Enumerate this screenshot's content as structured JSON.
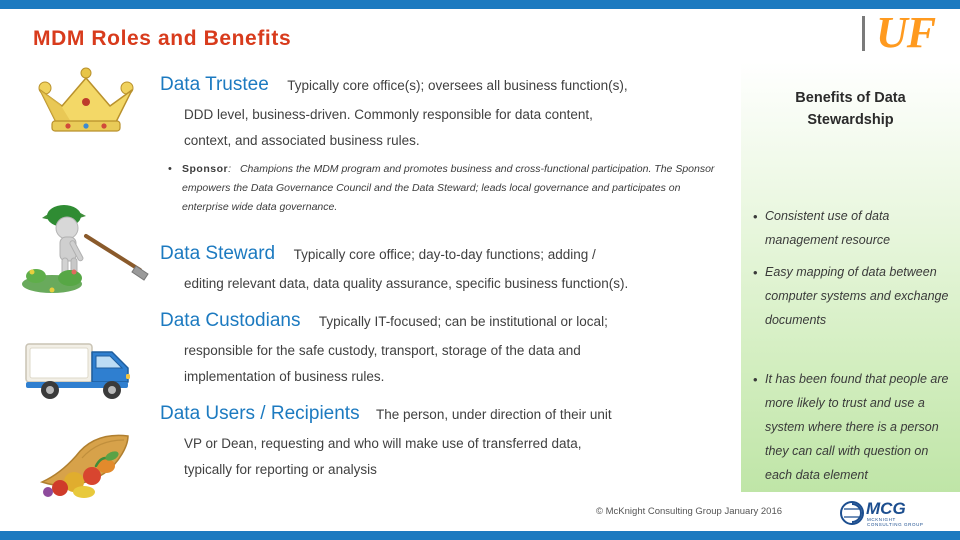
{
  "slide": {
    "title": "MDM Roles and Benefits",
    "logo": {
      "name": "UF",
      "divider": "|"
    }
  },
  "sections": [
    {
      "heading": "Data Trustee",
      "lead": "Typically core office(s); oversees all business function(s),",
      "lines": [
        "DDD level, business-driven.  Commonly responsible for data content,",
        "context, and associated business rules."
      ],
      "icon": "crown-icon"
    },
    {
      "heading": "Data Steward",
      "lead": "Typically core office; day-to-day functions; adding /",
      "lines": [
        "editing relevant data, data quality assurance, specific business function(s)."
      ],
      "icon": "gardener-icon"
    },
    {
      "heading": "Data Custodians",
      "lead": "Typically IT-focused; can be institutional or local;",
      "lines": [
        "responsible for the safe custody, transport, storage of the data and",
        "implementation of business rules."
      ],
      "icon": "truck-icon"
    },
    {
      "heading": "Data Users / Recipients",
      "lead": "The person, under direction of their unit",
      "lines": [
        "VP or Dean, requesting and who will make use of transferred data,",
        "typically for reporting or analysis"
      ],
      "icon": "cornucopia-icon"
    }
  ],
  "sponsor": {
    "bullet": "•",
    "label": "Sponsor",
    "colon": ":",
    "text": "Champions the MDM program and promotes business and cross-functional participation. The Sponsor empowers the Data Governance Council and the Data Steward; leads local governance and participates on enterprise wide data governance."
  },
  "benefits": {
    "title_line1": "Benefits of Data",
    "title_line2": "Stewardship",
    "bullet": "•",
    "items": [
      "Consistent use of data management resource",
      "Easy mapping of data between computer systems and exchange documents",
      "It has been found that people are more likely to trust and use a system where there is a person they can call with question on each data element"
    ]
  },
  "footer": {
    "copyright": "© McKnight Consulting Group January 2016",
    "logo_text": "MCG",
    "logo_sub": "MCKNIGHT CONSULTING GROUP"
  },
  "colors": {
    "accent_bar": "#1c7ac0",
    "title": "#d83b1c",
    "heading": "#1c7ac0",
    "logo_orange": "#ff9a1f",
    "panel_green": "#bfe5a7"
  }
}
